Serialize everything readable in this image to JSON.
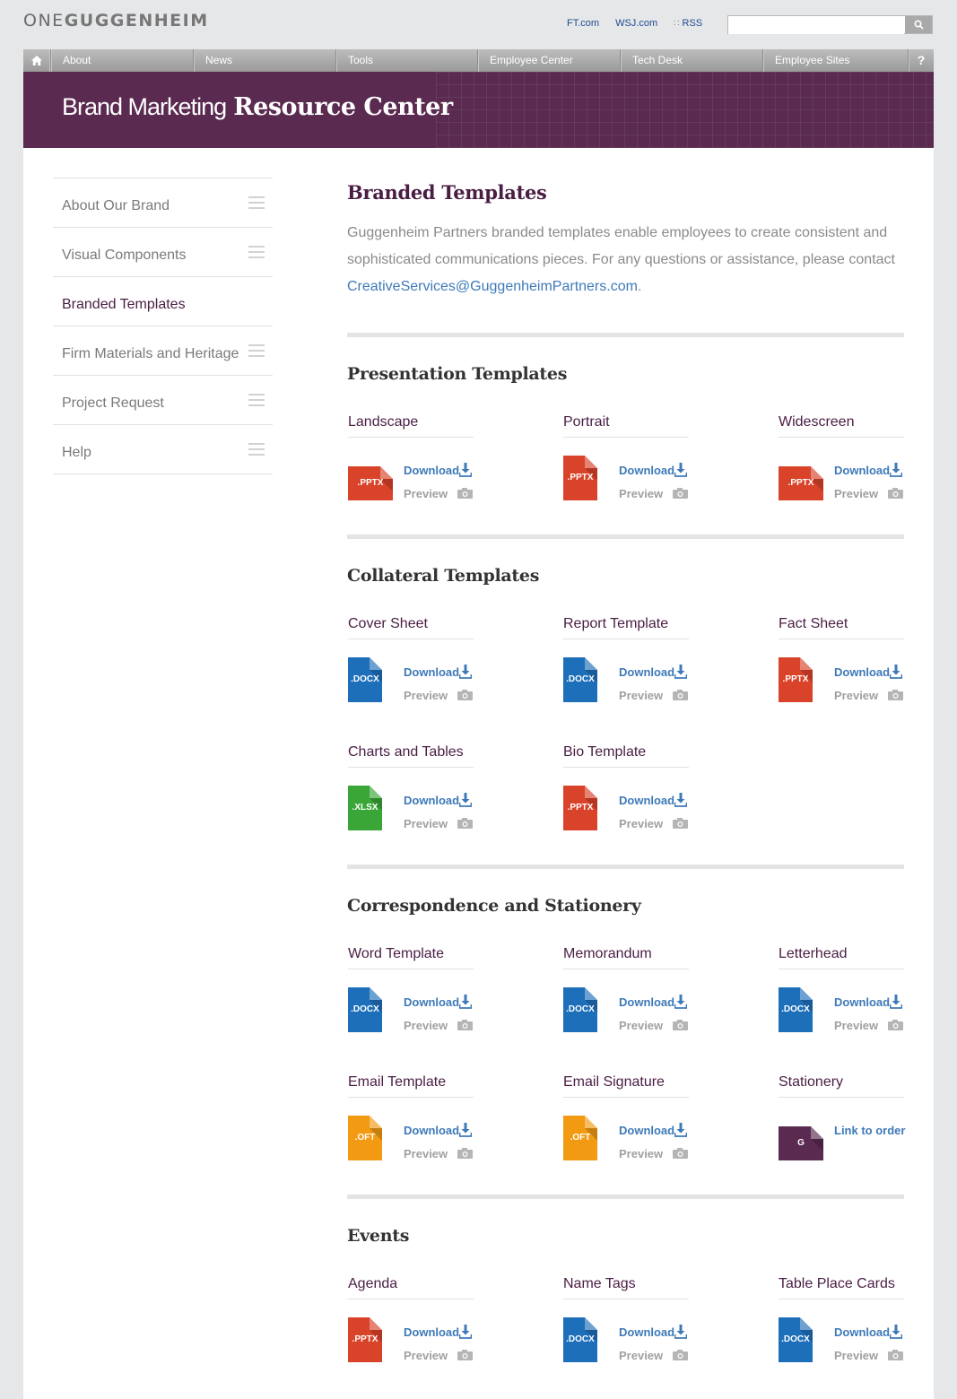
{
  "brand": {
    "logo_light": "ONE",
    "logo_bold": "GUGGENHEIM"
  },
  "toplinks": {
    "ft": "FT.com",
    "wsj": "WSJ.com",
    "rss": "RSS"
  },
  "search": {
    "placeholder": "",
    "value": ""
  },
  "nav": {
    "items": [
      "About",
      "News",
      "Tools",
      "Employee Center",
      "Tech Desk",
      "Employee Sites"
    ],
    "help": "?"
  },
  "banner": {
    "title_light": "Brand Marketing",
    "title_bold": "Resource Center"
  },
  "sidebar": {
    "items": [
      {
        "label": "About Our Brand"
      },
      {
        "label": "Visual Components"
      },
      {
        "label": "Branded Templates"
      },
      {
        "label": "Firm Materials and Heritage"
      },
      {
        "label": "Project Request"
      },
      {
        "label": "Help"
      }
    ]
  },
  "main": {
    "title": "Branded Templates",
    "intro": "Guggenheim Partners branded templates enable employees to create consistent and sophisticated communications pieces. For any questions or assistance, please contact",
    "email": "CreativeServices@GuggenheimPartners.com",
    "intro_end": ".",
    "download_label": "Download",
    "preview_label": "Preview",
    "link_to_order": "Link to order",
    "sections": [
      {
        "title": "Presentation Templates",
        "cards": [
          {
            "title": "Landscape",
            "ext": ".PPTX",
            "color": "#d9432a",
            "wide": true
          },
          {
            "title": "Portrait",
            "ext": ".PPTX",
            "color": "#d9432a"
          },
          {
            "title": "Widescreen",
            "ext": ".PPTX",
            "color": "#d9432a",
            "wide": true
          }
        ]
      },
      {
        "title": "Collateral Templates",
        "cards": [
          {
            "title": "Cover Sheet",
            "ext": ".DOCX",
            "color": "#1e6fba"
          },
          {
            "title": "Report Template",
            "ext": ".DOCX",
            "color": "#1e6fba"
          },
          {
            "title": "Fact Sheet",
            "ext": ".PPTX",
            "color": "#d9432a"
          },
          {
            "title": "Charts and Tables",
            "ext": ".XLSX",
            "color": "#3aa637"
          },
          {
            "title": "Bio Template",
            "ext": ".PPTX",
            "color": "#d9432a"
          }
        ]
      },
      {
        "title": "Correspondence and Stationery",
        "cards": [
          {
            "title": "Word Template",
            "ext": ".DOCX",
            "color": "#1e6fba"
          },
          {
            "title": "Memorandum",
            "ext": ".DOCX",
            "color": "#1e6fba"
          },
          {
            "title": "Letterhead",
            "ext": ".DOCX",
            "color": "#1e6fba"
          },
          {
            "title": "Email Template",
            "ext": ".OFT",
            "color": "#f29a12"
          },
          {
            "title": "Email Signature",
            "ext": ".OFT",
            "color": "#f29a12"
          },
          {
            "title": "Stationery",
            "ext": "G",
            "color": "#5a2a50",
            "wide": true,
            "order": true
          }
        ]
      },
      {
        "title": "Events",
        "cards": [
          {
            "title": "Agenda",
            "ext": ".PPTX",
            "color": "#d9432a"
          },
          {
            "title": "Name Tags",
            "ext": ".DOCX",
            "color": "#1e6fba"
          },
          {
            "title": "Table Place Cards",
            "ext": ".DOCX",
            "color": "#1e6fba"
          }
        ]
      }
    ]
  }
}
